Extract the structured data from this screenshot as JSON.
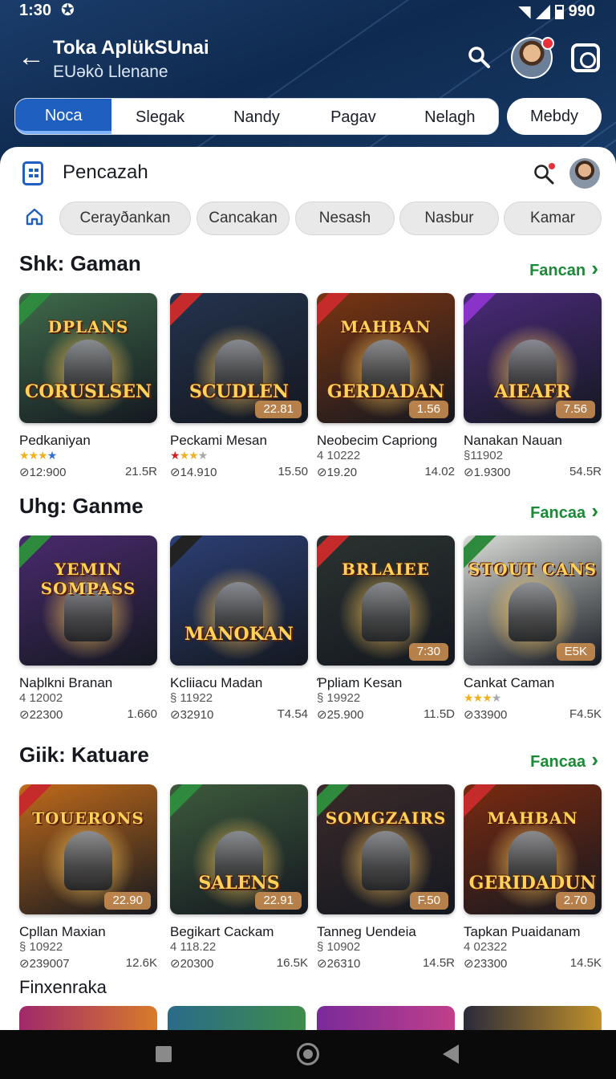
{
  "status": {
    "time": "1:30",
    "battery": "990"
  },
  "appbar": {
    "title": "Toka AplükSUnai",
    "subtitle": "EUəkò Llenane"
  },
  "tabs": [
    "Noca",
    "Slegak",
    "Nandy",
    "Pagav",
    "Nelagh"
  ],
  "tab_extra": "Mebdy",
  "sheet": {
    "title": "Pencazah"
  },
  "chips": [
    "Cerayðankan",
    "Cancakan",
    "Nesash",
    "Nasbur",
    "Kamar"
  ],
  "sections": [
    {
      "title": "Shk: Gaman",
      "see_all": "Fancan",
      "cards": [
        {
          "name": "Pedkaniyan",
          "rating_stars": 4,
          "sub": "",
          "meta_left": "⊘12:900",
          "meta_right": "21.5R",
          "badge": "",
          "art_top": "DPLANS",
          "art_bottom": "CORUSLSEN",
          "bg": "#3f6a4a",
          "ribbon": "#2e8b3d"
        },
        {
          "name": "Peckami Mesan",
          "rating_stars": 3,
          "sub": "",
          "meta_left": "⊘14.910",
          "meta_right": "15.50",
          "badge": "22.81",
          "art_top": "",
          "art_bottom": "SCUDLEN",
          "bg": "#24334d",
          "ribbon": "#c62b2b"
        },
        {
          "name": "Neobecim Capriong",
          "rating_stars": 0,
          "sub": "4 10222",
          "meta_left": "⊘19.20",
          "meta_right": "14.02",
          "badge": "1.56",
          "art_top": "MAHBAN",
          "art_bottom": "GERDADAN",
          "bg": "#7a3512",
          "ribbon": "#c62b2b"
        },
        {
          "name": "Nanakan Nauan",
          "rating_stars": 0,
          "sub": "§11902",
          "meta_left": "⊘1.9300",
          "meta_right": "54.5R",
          "badge": "7.56",
          "art_top": "",
          "art_bottom": "AIEAFR",
          "bg": "#4a2a7a",
          "ribbon": "#8a33c9"
        }
      ]
    },
    {
      "title": "Uhg: Ganme",
      "see_all": "Fancaa",
      "cards": [
        {
          "name": "Naþlkni Branan",
          "rating_stars": 0,
          "sub": "4 12002",
          "meta_left": "⊘22300",
          "meta_right": "1.660",
          "badge": "",
          "art_top": "YEMIN SOMPASS",
          "art_bottom": "",
          "bg": "#4a2a6e",
          "ribbon": "#2e8b3d"
        },
        {
          "name": "Kcliiacu Madan",
          "rating_stars": 0,
          "sub": "§ 11922",
          "meta_left": "⊘32910",
          "meta_right": "T4.54",
          "badge": "",
          "art_top": "",
          "art_bottom": "MANOKAN",
          "bg": "#2c3f74",
          "ribbon": "#222222"
        },
        {
          "name": "Ƥpliam Kesan",
          "rating_stars": 0,
          "sub": "§ 19922",
          "meta_left": "⊘25.900",
          "meta_right": "11.5D",
          "badge": "7:30",
          "art_top": "BRLAIEE",
          "art_bottom": "",
          "bg": "#2b3330",
          "ribbon": "#c62b2b"
        },
        {
          "name": "Cankat Caman",
          "rating_stars": 3,
          "sub": "",
          "meta_left": "⊘33900",
          "meta_right": "F4.5K",
          "badge": "E5K",
          "art_top": "STOUT CANS",
          "art_bottom": "",
          "bg": "#d9dcd6",
          "ribbon": "#2e8b3d"
        }
      ]
    },
    {
      "title": "Giik: Katuare",
      "see_all": "Fancaa",
      "cards": [
        {
          "name": "Cpllan Maxian",
          "rating_stars": 0,
          "sub": "§ 10922",
          "meta_left": "⊘239007",
          "meta_right": "12.6K",
          "badge": "22.90",
          "art_top": "TOUERONS",
          "art_bottom": "",
          "bg": "#c06a1a",
          "ribbon": "#c62b2b"
        },
        {
          "name": "Begikart Cackam",
          "rating_stars": 0,
          "sub": "4 118.22",
          "meta_left": "⊘20300",
          "meta_right": "16.5K",
          "badge": "22.91",
          "art_top": "",
          "art_bottom": "SALENS",
          "bg": "#3d5a3c",
          "ribbon": "#2e8b3d"
        },
        {
          "name": "Tanneg Uendeia",
          "rating_stars": 0,
          "sub": "§ 10902",
          "meta_left": "⊘26310",
          "meta_right": "14.5R",
          "badge": "F.50",
          "art_top": "SOMGZAIRS",
          "art_bottom": "",
          "bg": "#3a2a2a",
          "ribbon": "#2e8b3d"
        },
        {
          "name": "Tapkan Puaidanam",
          "rating_stars": 0,
          "sub": "4 02322",
          "meta_left": "⊘23300",
          "meta_right": "14.5K",
          "badge": "2.70",
          "art_top": "MAHBAN",
          "art_bottom": "GERIDADUN",
          "bg": "#7a2a10",
          "ribbon": "#c62b2b"
        }
      ]
    }
  ],
  "footer_label": "Finxenraka"
}
